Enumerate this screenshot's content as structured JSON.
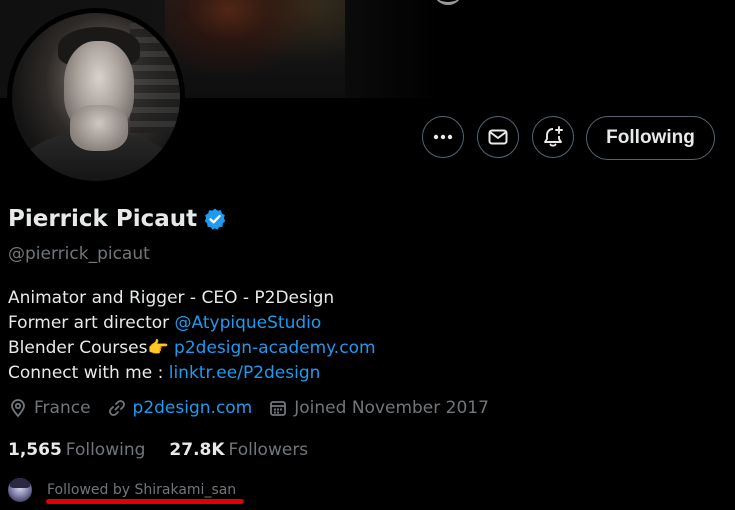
{
  "profile": {
    "display_name": "Pierrick Picaut",
    "handle": "@pierrick_picaut",
    "verified": true
  },
  "actions": {
    "more_icon": "more-dots-icon",
    "message_icon": "mail-icon",
    "notify_icon": "bell-plus-icon",
    "follow_label": "Following"
  },
  "bio": {
    "line1": "Animator and Rigger - CEO - P2Design",
    "line2_text": "Former art director ",
    "line2_link": "@AtypiqueStudio",
    "line3_text": "Blender Courses👉 ",
    "line3_link": "p2design-academy.com",
    "line4_text": "Connect with me : ",
    "line4_link": "linktr.ee/P2design"
  },
  "meta": {
    "location": "France",
    "website": "p2design.com",
    "joined": "Joined November 2017"
  },
  "stats": {
    "following_count": "1,565",
    "following_label": "Following",
    "followers_count": "27.8K",
    "followers_label": "Followers"
  },
  "followed_by": "Followed by Shirakami_san",
  "colors": {
    "background": "#000000",
    "text": "#e7e9ea",
    "muted": "#71767b",
    "link": "#1d9bf0",
    "border": "#536471",
    "annotation": "#e00000"
  }
}
